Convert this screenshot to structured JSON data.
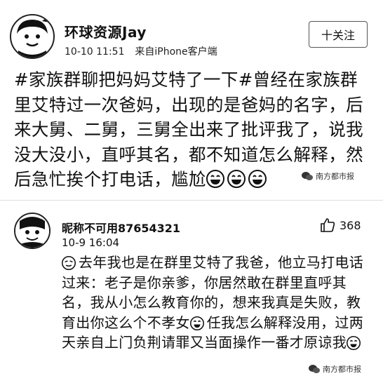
{
  "post": {
    "author_name": "环球资源Jay",
    "timestamp": "10-10 11:51",
    "source": "来自iPhone客户端",
    "follow_label": "十关注",
    "text": "#家族群聊把妈妈艾特了一下#曾经在家族群里艾特过一次爸妈，出现的是爸妈的名字，后来大舅、二舅，三舅全出来了批评我了，说我没大没小，直呼其名，都不知道怎么解释，然后急忙挨个打电话，尴尬",
    "trailing_emoji": [
      "grin-emoji",
      "grin-emoji",
      "grin-emoji"
    ]
  },
  "comment": {
    "author_name": "昵称不可用87654321",
    "timestamp": "10-9 16:04",
    "like_count": "368",
    "text": "去年我也是在群里艾特了我爸，他立马打电话过来：老子是你亲爹，你居然敢在群里直呼其名，我从小怎么教育你的，想来我真是失败，教育出你这么个不孝女",
    "text_tail": "任我怎么解释没用，过两天亲自上门负荆请罪又当面操作一番才原谅我"
  },
  "watermark": {
    "label": "南方都市报"
  }
}
